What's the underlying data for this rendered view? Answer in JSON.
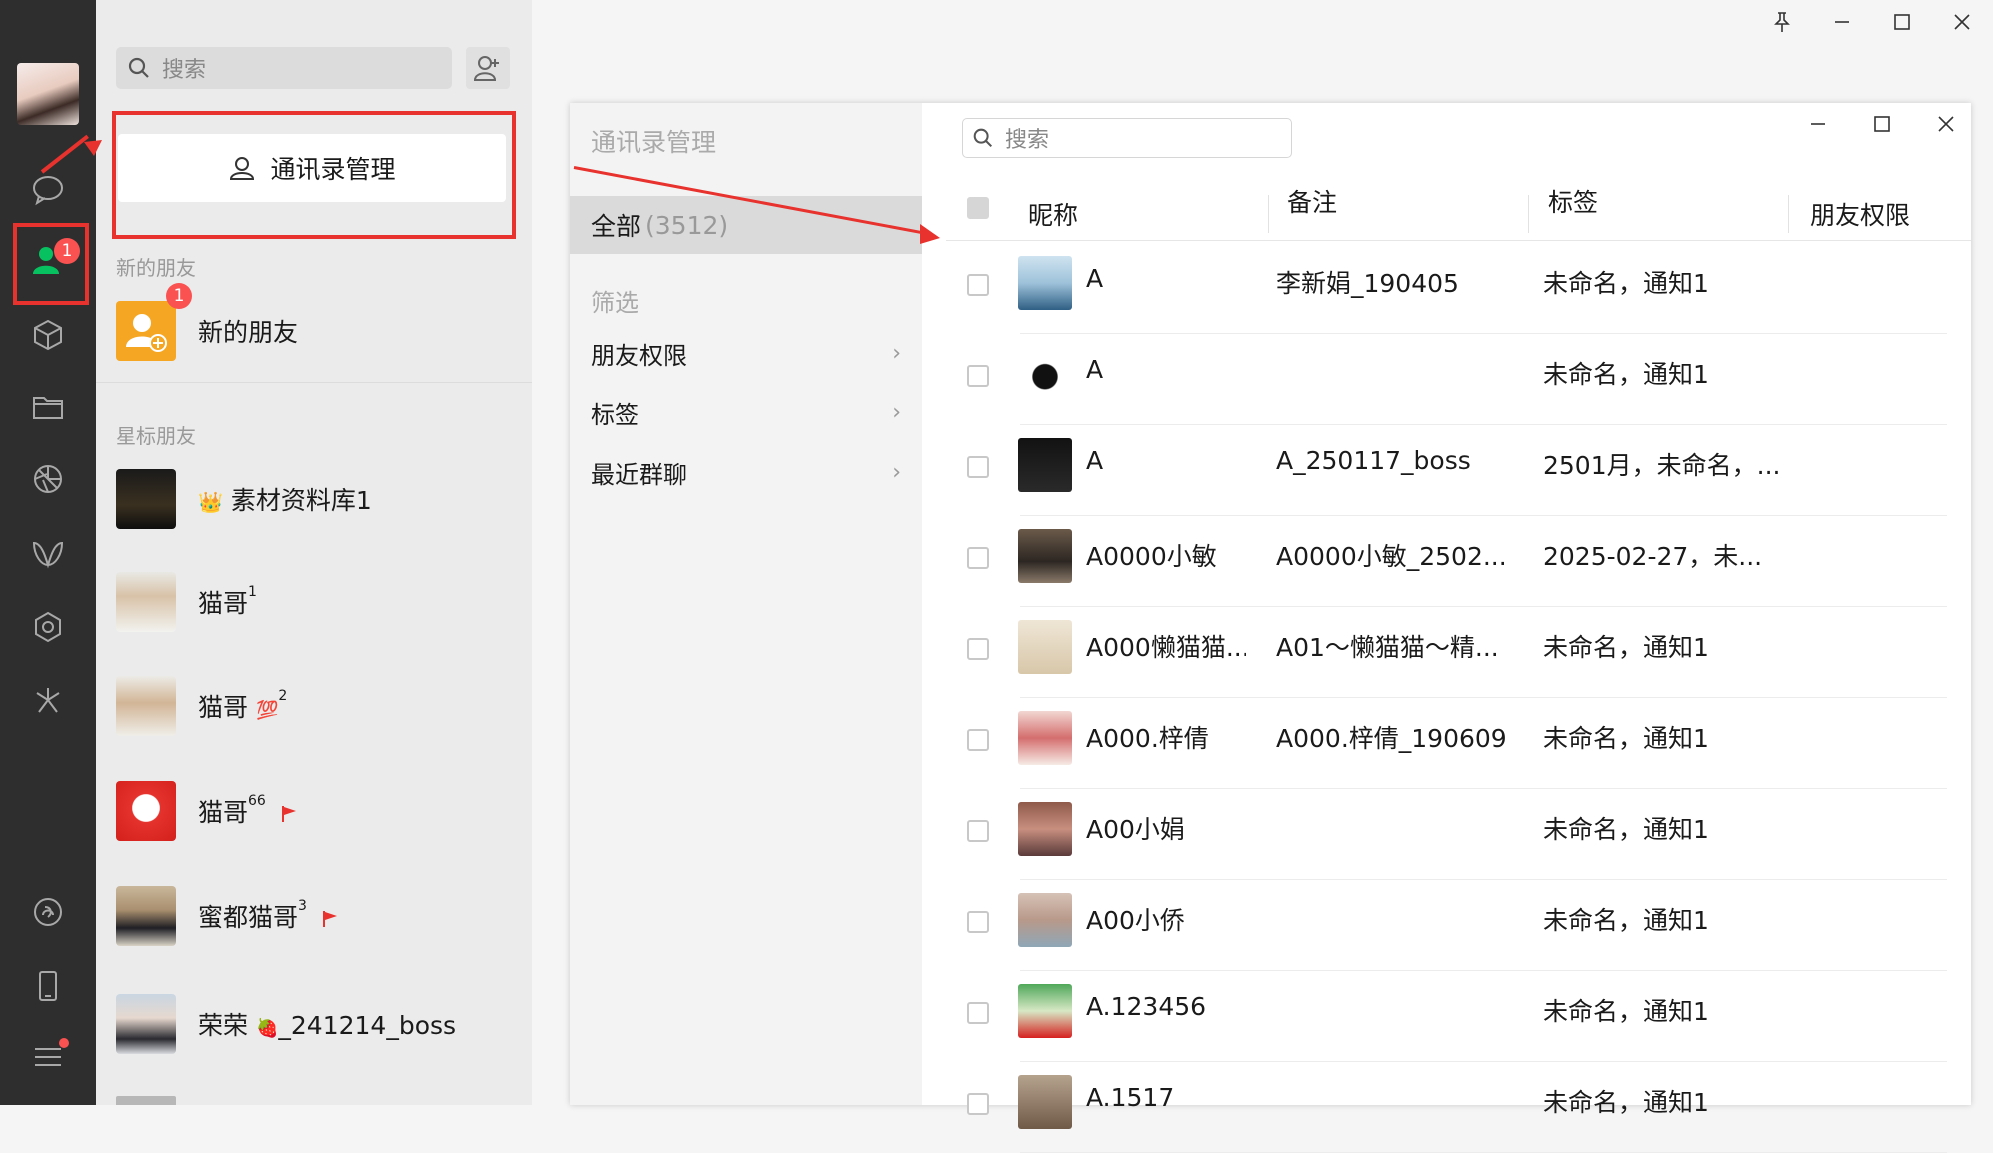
{
  "rail": {
    "badge": "1"
  },
  "contacts_panel": {
    "search_placeholder": "搜索",
    "manage_button": "通讯录管理",
    "section_new": "新的朋友",
    "new_friends": {
      "label": "新的朋友",
      "badge": "1"
    },
    "section_starred": "星标朋友",
    "starred": [
      {
        "name": "素材资料库1",
        "prefix_emoji": "👑",
        "sup": ""
      },
      {
        "name": "猫哥",
        "sup": "1"
      },
      {
        "name": "猫哥",
        "tag": "💯",
        "sup": "2"
      },
      {
        "name": "猫哥",
        "sup": "66",
        "flag": true
      },
      {
        "name": "蜜都猫哥",
        "sup": "3",
        "flag": true
      },
      {
        "name": "荣荣",
        "tag": "🍓",
        "suffix": "_241214_boss"
      }
    ]
  },
  "dialog": {
    "title": "通讯录管理",
    "all_label": "全部",
    "all_count": "(3512)",
    "filter_label": "筛选",
    "filters": [
      "朋友权限",
      "标签",
      "最近群聊"
    ],
    "search_placeholder": "搜索",
    "columns": [
      "昵称",
      "备注",
      "标签",
      "朋友权限"
    ],
    "rows": [
      {
        "nickname": "A",
        "remark": "李新娟_190405",
        "tags": "未命名，通知1"
      },
      {
        "nickname": "A",
        "remark": "",
        "tags": "未命名，通知1"
      },
      {
        "nickname": "A",
        "remark": "A_250117_boss",
        "tags": "2501月，未命名，..."
      },
      {
        "nickname": "A0000小敏",
        "remark": "A0000小敏_2502...",
        "tags": "2025-02-27，未..."
      },
      {
        "nickname": "A000懒猫猫...",
        "remark": "A01～懒猫猫～精...",
        "tags": "未命名，通知1"
      },
      {
        "nickname": "A000.梓倩",
        "remark": "A000.梓倩_190609",
        "tags": "未命名，通知1"
      },
      {
        "nickname": "A00小娟",
        "remark": "",
        "tags": "未命名，通知1"
      },
      {
        "nickname": "A00小侨",
        "remark": "",
        "tags": "未命名，通知1"
      },
      {
        "nickname": "A.123456",
        "remark": "",
        "tags": "未命名，通知1"
      },
      {
        "nickname": "A.1517",
        "remark": "",
        "tags": "未命名，通知1"
      }
    ]
  },
  "colors": {
    "rail_bg": "#2e2e2e",
    "list_bg": "#ebebeb",
    "highlight_red": "#e8322d",
    "badge_red": "#fa5151",
    "wechat_green": "#07c160"
  }
}
